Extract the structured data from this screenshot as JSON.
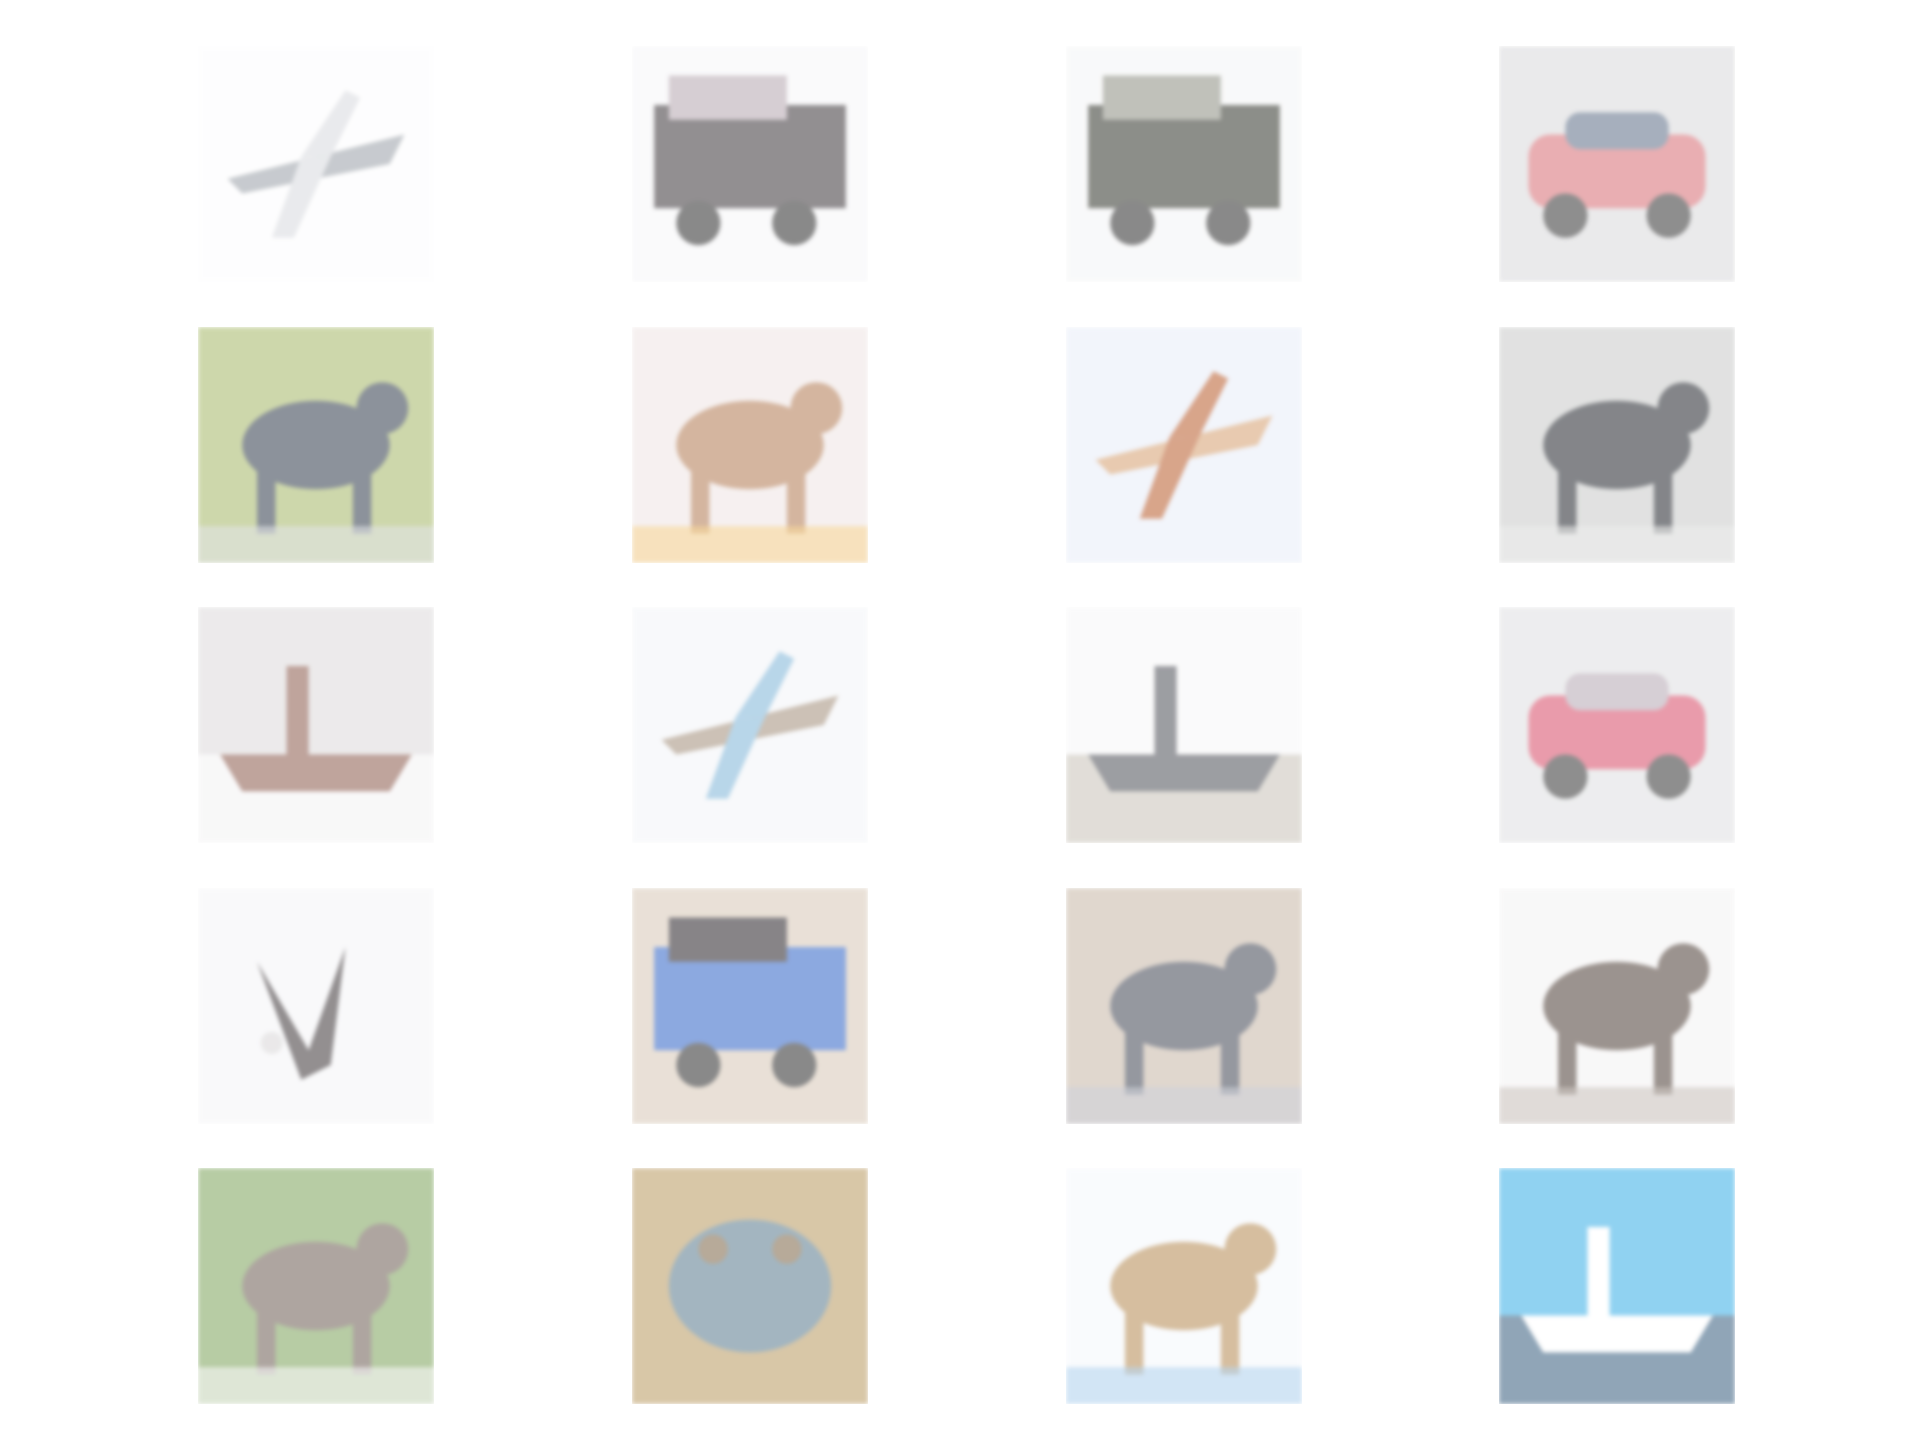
{
  "figure": {
    "layout": "grid",
    "rows": 5,
    "columns": 4,
    "background": "#ffffff",
    "tiles": [
      {
        "subject": "helicopter",
        "bg": "#fdfdfe",
        "fg": "#9aa0a8",
        "accent": "#d8dadf"
      },
      {
        "subject": "truck",
        "bg": "#f6f6f8",
        "fg": "#3a3438",
        "accent": "#b6a7b0"
      },
      {
        "subject": "jeep",
        "bg": "#f4f5f6",
        "fg": "#2f3229",
        "accent": "#8d8f83"
      },
      {
        "subject": "car",
        "bg": "#d9d9db",
        "fg": "#d86d74",
        "accent": "#5e6f88"
      },
      {
        "subject": "horse",
        "bg": "#a6b868",
        "fg": "#2f3a4a",
        "accent": "#c9cdd1"
      },
      {
        "subject": "dog",
        "bg": "#efe5e4",
        "fg": "#b27a52",
        "accent": "#f2b84b"
      },
      {
        "subject": "airplane",
        "bg": "#e8edf8",
        "fg": "#d6a070",
        "accent": "#b95c2c"
      },
      {
        "subject": "horses",
        "bg": "#c9cac9",
        "fg": "#20232a",
        "accent": "#e0e0e0"
      },
      {
        "subject": "boat",
        "bg": "#dddadb",
        "fg": "#8b5a4c",
        "accent": "#f4f3f4"
      },
      {
        "subject": "airplane",
        "bg": "#f3f5f8",
        "fg": "#a38f7b",
        "accent": "#7fb5d8"
      },
      {
        "subject": "ships",
        "bg": "#f7f7f8",
        "fg": "#4d4f57",
        "accent": "#c9c3b9"
      },
      {
        "subject": "car",
        "bg": "#dfe0e2",
        "fg": "#d84b67",
        "accent": "#b6a8b4"
      },
      {
        "subject": "bird",
        "bg": "#f5f5f7",
        "fg": "#3b3436",
        "accent": "#d9d7d8"
      },
      {
        "subject": "truck",
        "bg": "#d8c8b7",
        "fg": "#2f63c7",
        "accent": "#262126"
      },
      {
        "subject": "elephant",
        "bg": "#c7b7a7",
        "fg": "#3f4452",
        "accent": "#a8aebd"
      },
      {
        "subject": "deer",
        "bg": "#f4f3f3",
        "fg": "#4b3c34",
        "accent": "#a89c94"
      },
      {
        "subject": "deer",
        "bg": "#7da35a",
        "fg": "#6d5d54",
        "accent": "#f4f4f4"
      },
      {
        "subject": "frog",
        "bg": "#b99a61",
        "fg": "#587a8e",
        "accent": "#7d6546"
      },
      {
        "subject": "cat",
        "bg": "#f5f8fc",
        "fg": "#b58a52",
        "accent": "#7fb5e4"
      },
      {
        "subject": "ship",
        "bg": "#37aee7",
        "fg": "#ffffff",
        "accent": "#365d7e"
      }
    ]
  }
}
